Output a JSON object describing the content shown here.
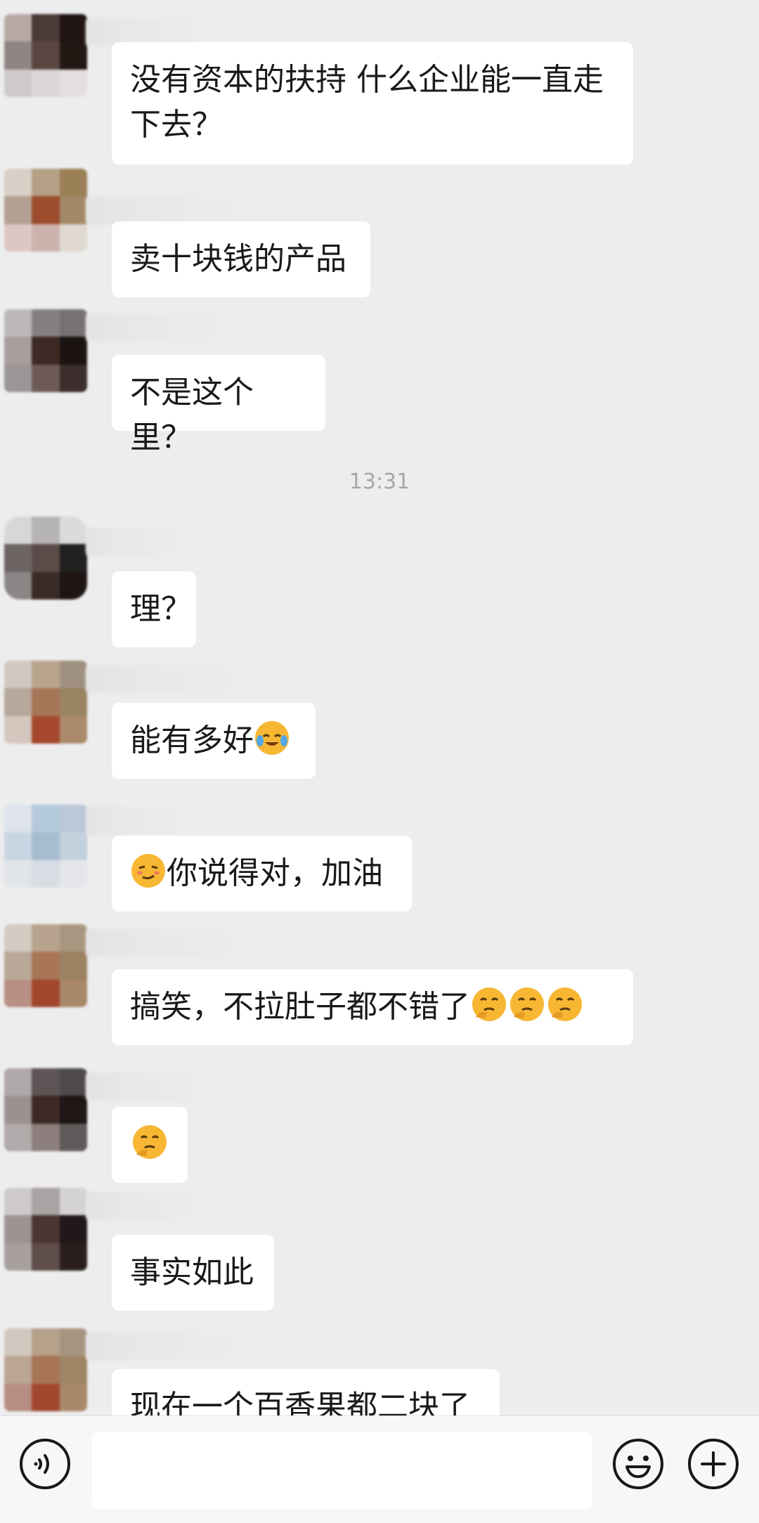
{
  "messages": [
    {
      "text": "没有资本的扶持 什么企业能一直走下去？"
    },
    {
      "text": "卖十块钱的产品"
    },
    {
      "text": "不是这个里？"
    },
    {
      "text": "理？"
    },
    {
      "text": "能有多好",
      "emoji": [
        "laughing-crying-emoji"
      ]
    },
    {
      "text": "你说得对，加油",
      "emoji_before": "smirk-emoji"
    },
    {
      "text": "搞笑，不拉肚子都不错了",
      "emoji": [
        "thinking-emoji",
        "thinking-emoji",
        "thinking-emoji"
      ]
    },
    {
      "text": "",
      "emoji": [
        "thinking-emoji"
      ]
    },
    {
      "text": "事实如此"
    },
    {
      "text": "现在一个百香果都二块了"
    }
  ],
  "timestamp": "13:31",
  "input": {
    "value": "",
    "placeholder": ""
  },
  "icons": {
    "voice": "voice-icon",
    "emoji": "emoji-icon",
    "more": "plus-icon"
  },
  "colors": {
    "background": "#ededed",
    "bubble": "#ffffff",
    "text": "#191919",
    "time": "#a7a7a7"
  }
}
